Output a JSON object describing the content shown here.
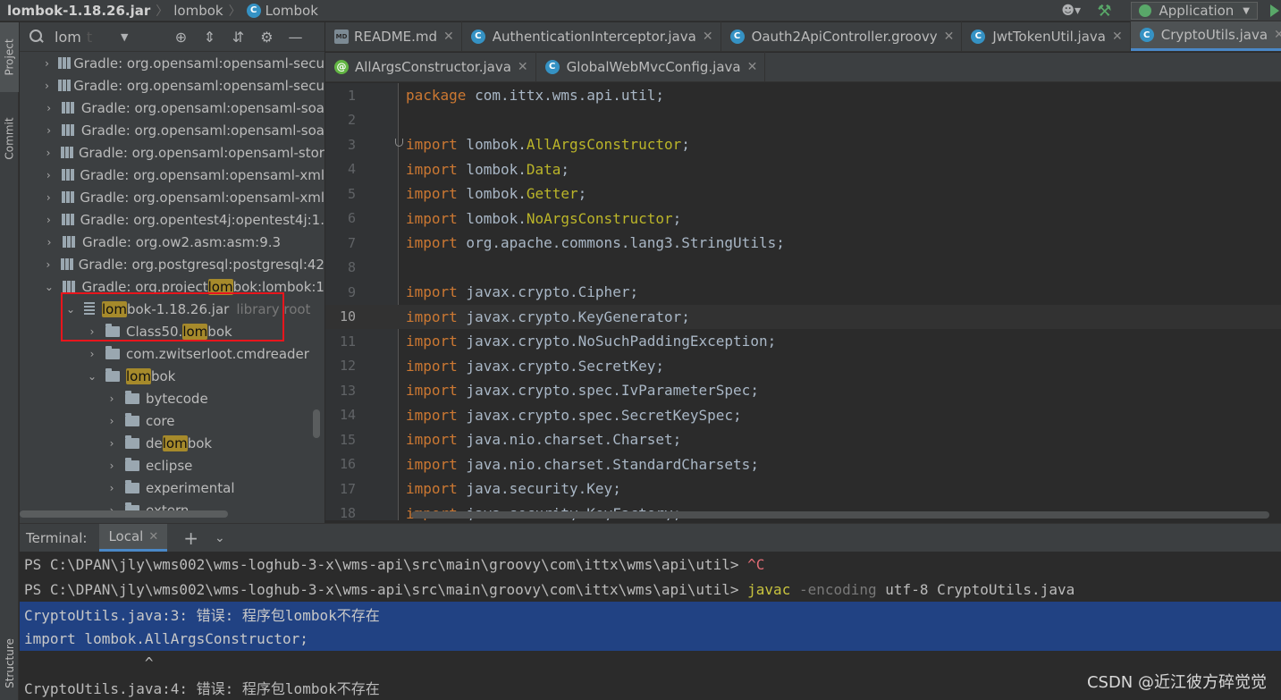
{
  "breadcrumb": {
    "jar": "lombok-1.18.26.jar",
    "folder": "lombok",
    "class_name": "Lombok",
    "class_badge": "C"
  },
  "toolbar": {
    "run_config": "Application",
    "run_config_caret": "▼"
  },
  "left_strip": {
    "project_label": "Project",
    "commit_label": "Commit",
    "structure_label": "Structure"
  },
  "project_panel": {
    "search_value": "lom",
    "search_cursor": "t",
    "tree": [
      {
        "text": "Gradle: org.opensaml:opensaml-secu",
        "indent": 0
      },
      {
        "text": "Gradle: org.opensaml:opensaml-secu",
        "indent": 0
      },
      {
        "text": "Gradle: org.opensaml:opensaml-soa",
        "indent": 0
      },
      {
        "text": "Gradle: org.opensaml:opensaml-soa",
        "indent": 0
      },
      {
        "text": "Gradle: org.opensaml:opensaml-stor",
        "indent": 0
      },
      {
        "text": "Gradle: org.opensaml:opensaml-xml",
        "indent": 0
      },
      {
        "text": "Gradle: org.opensaml:opensaml-xml",
        "indent": 0
      },
      {
        "text": "Gradle: org.opentest4j:opentest4j:1.",
        "indent": 0
      },
      {
        "text": "Gradle: org.ow2.asm:asm:9.3",
        "indent": 0
      },
      {
        "text": "Gradle: org.postgresql:postgresql:42",
        "indent": 0
      }
    ],
    "lombok_lib": {
      "pre": "Gradle: org.project",
      "hl": "lom",
      "post": "bok:lombok:1"
    },
    "jar_row": {
      "hl": "lom",
      "post": "bok-1.18.26.jar",
      "suffix": "library root"
    },
    "class50_row": {
      "pre": "Class50.",
      "hl": "lom",
      "post": "bok"
    },
    "cmdreader_row": "com.zwitserloot.cmdreader",
    "lombok_pkg": {
      "hl": "lom",
      "post": "bok"
    },
    "sub_packages": [
      "bytecode",
      "core",
      "eclipse",
      "experimental",
      "extern"
    ],
    "delombok_row": {
      "pre": "de",
      "hl": "lom",
      "post": "bok"
    }
  },
  "editor_tabs_row1": [
    {
      "label": "README.md",
      "icon": "markdown-icon"
    },
    {
      "label": "AuthenticationInterceptor.java",
      "icon": "class-icon"
    },
    {
      "label": "Oauth2ApiController.groovy",
      "icon": "class-icon"
    },
    {
      "label": "JwtTokenUtil.java",
      "icon": "class-icon"
    },
    {
      "label": "CryptoUtils.java",
      "icon": "class-icon",
      "active": true
    }
  ],
  "editor_tabs_row2": [
    {
      "label": "AllArgsConstructor.java",
      "icon": "annotation-icon"
    },
    {
      "label": "GlobalWebMvcConfig.java",
      "icon": "class-icon"
    }
  ],
  "code": {
    "current_line": 10,
    "lines": [
      {
        "n": "1",
        "kw": "package",
        "rest": " com.ittx.wms.api.util;",
        "ann": ""
      },
      {
        "n": "2",
        "kw": "",
        "rest": "",
        "ann": ""
      },
      {
        "n": "3",
        "kw": "import",
        "pre": " lombok.",
        "ann": "AllArgsConstructor",
        "rest": ";"
      },
      {
        "n": "4",
        "kw": "import",
        "pre": " lombok.",
        "ann": "Data",
        "rest": ";"
      },
      {
        "n": "5",
        "kw": "import",
        "pre": " lombok.",
        "ann": "Getter",
        "rest": ";"
      },
      {
        "n": "6",
        "kw": "import",
        "pre": " lombok.",
        "ann": "NoArgsConstructor",
        "rest": ";"
      },
      {
        "n": "7",
        "kw": "import",
        "rest": " org.apache.commons.lang3.StringUtils;",
        "ann": ""
      },
      {
        "n": "8",
        "kw": "",
        "rest": "",
        "ann": ""
      },
      {
        "n": "9",
        "kw": "import",
        "rest": " javax.crypto.Cipher;",
        "ann": ""
      },
      {
        "n": "10",
        "kw": "import",
        "rest": " javax.crypto.KeyGenerator;",
        "ann": ""
      },
      {
        "n": "11",
        "kw": "import",
        "rest": " javax.crypto.NoSuchPaddingException;",
        "ann": ""
      },
      {
        "n": "12",
        "kw": "import",
        "rest": " javax.crypto.SecretKey;",
        "ann": ""
      },
      {
        "n": "13",
        "kw": "import",
        "rest": " javax.crypto.spec.IvParameterSpec;",
        "ann": ""
      },
      {
        "n": "14",
        "kw": "import",
        "rest": " javax.crypto.spec.SecretKeySpec;",
        "ann": ""
      },
      {
        "n": "15",
        "kw": "import",
        "rest": " java.nio.charset.Charset;",
        "ann": ""
      },
      {
        "n": "16",
        "kw": "import",
        "rest": " java.nio.charset.StandardCharsets;",
        "ann": ""
      },
      {
        "n": "17",
        "kw": "import",
        "rest": " java.security.Key;",
        "ann": ""
      },
      {
        "n": "18",
        "kw": "import",
        "rest": " java.security.KeyFactory;",
        "ann": ""
      }
    ]
  },
  "terminal": {
    "title": "Terminal:",
    "tab": "Local",
    "plus": "+",
    "prompt": "PS C:\\DPAN\\jly\\wms002\\wms-loghub-3-x\\wms-api\\src\\main\\groovy\\com\\ittx\\wms\\api\\util> ",
    "ctrl_c": "^C",
    "cmd": "javac",
    "opt": " -encoding",
    "args": " utf-8 CryptoUtils.java",
    "error1": "CryptoUtils.java:3: 错误: 程序包lombok不存在",
    "error1_src": "import lombok.AllArgsConstructor;",
    "caret": "              ^",
    "error2": "CryptoUtils.java:4: 错误: 程序包lombok不存在"
  },
  "watermark": "CSDN @近江彼方碎觉觉"
}
